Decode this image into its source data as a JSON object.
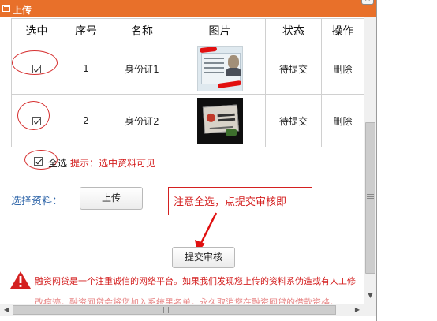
{
  "dialog": {
    "title": "上传",
    "accent_color": "#e8702a",
    "icons": {
      "title": "window-icon",
      "close": "close-icon"
    }
  },
  "table": {
    "headers": [
      "选中",
      "序号",
      "名称",
      "图片",
      "状态",
      "操作"
    ],
    "rows": [
      {
        "selected": true,
        "index": "1",
        "name": "身份证1",
        "image": "id-card-front-thumbnail",
        "status": "待提交",
        "action": "删除"
      },
      {
        "selected": true,
        "index": "2",
        "name": "身份证2",
        "image": "id-card-back-thumbnail",
        "status": "待提交",
        "action": "删除"
      }
    ]
  },
  "select_all": {
    "checked": true,
    "label": "全选",
    "hint": "提示：选中资料可见"
  },
  "upload": {
    "label": "选择资料：",
    "button_label": "上传"
  },
  "annotation": {
    "text": "注意全选，点提交审核即",
    "color": "#d42020"
  },
  "submit": {
    "button_label": "提交审核"
  },
  "warning": {
    "icon": "warning-triangle-icon",
    "line1": "融资网贷是一个注重诚信的网络平台。如果我们发现您上传的资料系伪造或有人工修",
    "line2": "改痕迹，融资网贷会将您加入系统黑名单，永久取消您在融资网贷的借款资格。"
  }
}
